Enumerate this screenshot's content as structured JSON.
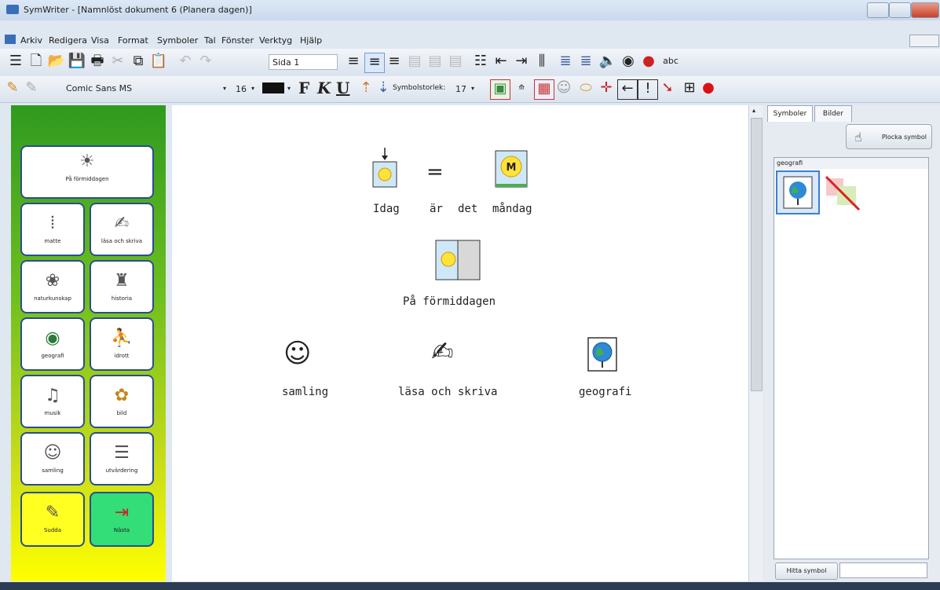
{
  "window": {
    "title": "SymWriter - [Namnlöst dokument 6 (Planera dagen)]"
  },
  "menu": [
    "Arkiv",
    "Redigera",
    "Visa",
    "Format",
    "Symboler",
    "Tal",
    "Fönster",
    "Verktyg",
    "Hjälp"
  ],
  "toolbar": {
    "page_label": "Sida 1",
    "font_name": "Comic Sans MS",
    "font_size": "16",
    "bold_label": "F",
    "italic_label": "K",
    "underline_label": "U",
    "symbol_size_label": "Symbolstorlek:",
    "symbol_size_value": "17"
  },
  "grid": {
    "title_button": "På förmiddagen",
    "buttons": [
      {
        "label": "matte",
        "icon": "abacus-icon"
      },
      {
        "label": "läsa och skriva",
        "icon": "read-write-icon"
      },
      {
        "label": "naturkunskap",
        "icon": "nature-icon"
      },
      {
        "label": "historia",
        "icon": "history-icon"
      },
      {
        "label": "geografi",
        "icon": "globe-icon"
      },
      {
        "label": "idrott",
        "icon": "sport-icon"
      },
      {
        "label": "musik",
        "icon": "music-icon"
      },
      {
        "label": "bild",
        "icon": "art-icon"
      },
      {
        "label": "samling",
        "icon": "gathering-icon"
      },
      {
        "label": "utvärdering",
        "icon": "evaluation-icon"
      }
    ],
    "erase_label": "Sudda",
    "next_label": "Nästa"
  },
  "document": {
    "line1": [
      "Idag",
      "är",
      "det",
      "måndag"
    ],
    "line2": "På förmiddagen",
    "line3": [
      "samling",
      "läsa och skriva",
      "geografi"
    ]
  },
  "symbols_panel": {
    "tabs": [
      "Symboler",
      "Bilder"
    ],
    "pick_button": "Plocka symbol",
    "group_label": "geografi",
    "find_button": "Hitta symbol"
  },
  "colors": {
    "panel_top": "#2f9a1f",
    "panel_bottom": "#ffff00",
    "button_border": "#2a4d8f"
  }
}
